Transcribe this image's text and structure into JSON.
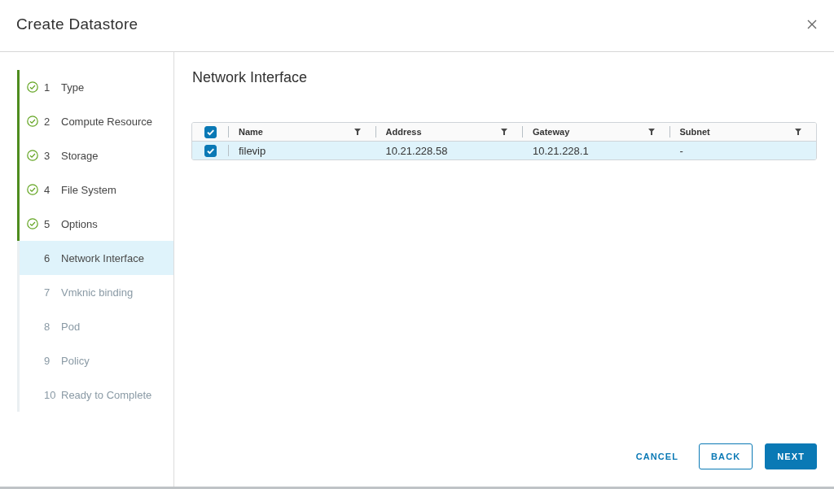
{
  "dialog": {
    "title": "Create Datastore"
  },
  "steps": [
    {
      "number": "1",
      "label": "Type",
      "completed": true,
      "selected": false
    },
    {
      "number": "2",
      "label": "Compute Resource",
      "completed": true,
      "selected": false
    },
    {
      "number": "3",
      "label": "Storage",
      "completed": true,
      "selected": false
    },
    {
      "number": "4",
      "label": "File System",
      "completed": true,
      "selected": false
    },
    {
      "number": "5",
      "label": "Options",
      "completed": true,
      "selected": false
    },
    {
      "number": "6",
      "label": "Network Interface",
      "completed": false,
      "selected": true
    },
    {
      "number": "7",
      "label": "Vmknic binding",
      "completed": false,
      "selected": false
    },
    {
      "number": "8",
      "label": "Pod",
      "completed": false,
      "selected": false
    },
    {
      "number": "9",
      "label": "Policy",
      "completed": false,
      "selected": false
    },
    {
      "number": "10",
      "label": "Ready to Complete",
      "completed": false,
      "selected": false
    }
  ],
  "page": {
    "title": "Network Interface"
  },
  "table": {
    "select_all_checked": true,
    "columns": [
      "Name",
      "Address",
      "Gateway",
      "Subnet"
    ],
    "rows": [
      {
        "selected": true,
        "cells": [
          "filevip",
          "10.21.228.58",
          "10.21.228.1",
          "-"
        ]
      }
    ]
  },
  "buttons": [
    {
      "label": "CANCEL",
      "kind": "flat"
    },
    {
      "label": "BACK",
      "kind": "outline"
    },
    {
      "label": "NEXT",
      "kind": "primary"
    }
  ]
}
